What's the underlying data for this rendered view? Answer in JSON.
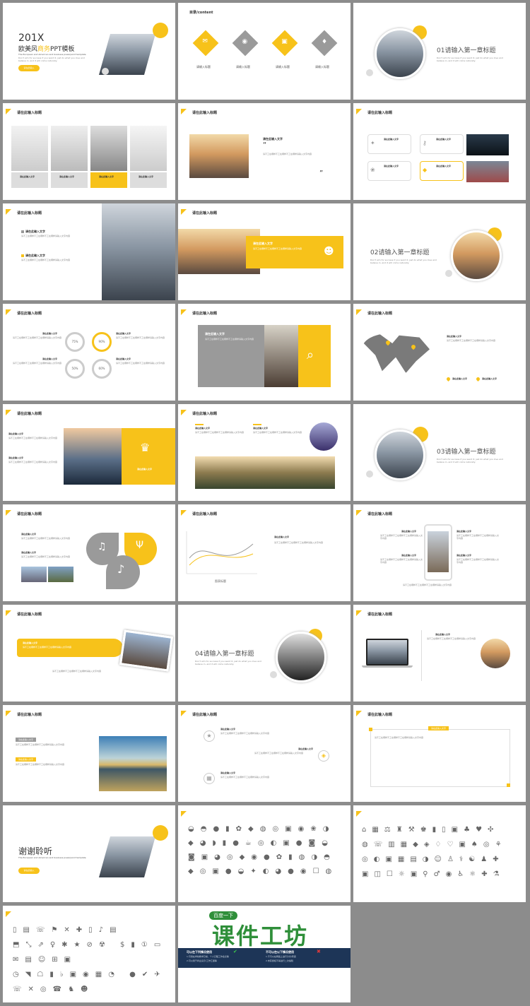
{
  "cover": {
    "year": "201X",
    "title_a": "欧美风",
    "title_b": "商务",
    "title_c": "PPT模板",
    "subtitle": "The European and American and business powerpoint template",
    "note": "Don't aim for success if you want it; just do what you love and believe in, and it will come naturally.",
    "button": "请在此输入"
  },
  "contents": {
    "title": "目录/content",
    "items": [
      "请输入标题",
      "请输入标题",
      "请输入标题",
      "请输入标题"
    ]
  },
  "chapters": {
    "c1": "01请输入第一章标题",
    "c2": "02请输入第一章标题",
    "c3": "03请输入第一章标题",
    "c4": "04请输入第一章标题",
    "desc": "Don't aim for success if you want it; just do what you love and believe in, and it will come naturally."
  },
  "common": {
    "slide_title": "请在此输入标题",
    "field": "请在此输入文字",
    "body": "请不工在哪样不工在哪样不工在哪样请输入文字内容",
    "chart_title": "图表标题"
  },
  "percent": [
    "75%",
    "90%",
    "50%",
    "60%"
  ],
  "thanks": {
    "title": "谢谢聆听",
    "subtitle": "The European and American and business powerpoint template",
    "button": "请在此输入"
  },
  "ad": {
    "top": "百度一下",
    "brand": "课件工坊",
    "left_head": "可以在下列情况使用",
    "right_head": "不可以在以下情况使用",
    "left_1": "1.可用在学校教学日常，个人日程工作会议等",
    "left_2": "2.可以用于商业演示/工作汇报等",
    "right_1": "1.不可以在网络上进行分享/转卖",
    "right_2": "2.未获授权不得进行二次编辑"
  },
  "icons": {
    "s1": [
      "bowl",
      "apple",
      "fish",
      "candy",
      "cup",
      "pepper",
      "pear",
      "egg",
      "cake",
      "pot",
      "bottle",
      "bread"
    ],
    "s2": [
      "bank",
      "calendar",
      "scale",
      "tower",
      "hammer",
      "trophy",
      "chart",
      "bottle",
      "lock",
      "globe",
      "phone"
    ],
    "s3": [
      "mouse",
      "monitor",
      "phone",
      "flag",
      "tablet",
      "sound",
      "printer",
      "gear",
      "dollar",
      "star",
      "mail"
    ]
  },
  "colors": {
    "accent": "#f7c21a",
    "grey": "#9a9a9a",
    "ad_green": "#2f8f3a",
    "ad_navy": "#1d3557"
  }
}
